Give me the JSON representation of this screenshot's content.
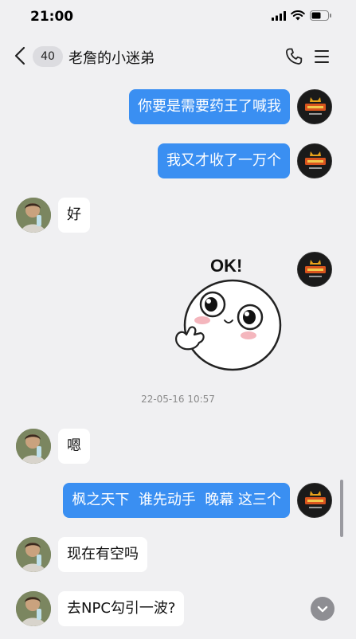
{
  "status_bar": {
    "time": "21:00"
  },
  "nav": {
    "unread_count": "40",
    "title": "老詹的小迷弟"
  },
  "messages": [
    {
      "side": "out",
      "text": "你要是需要药王了喊我"
    },
    {
      "side": "out",
      "text": "我又才收了一万个"
    },
    {
      "side": "in",
      "text": "好"
    },
    {
      "side": "out",
      "sticker": "ok-sticker",
      "sticker_text": "OK!"
    },
    {
      "side": "in",
      "text": "嗯"
    },
    {
      "side": "out",
      "text": "枫之天下  谁先动手  晚幕 这三个"
    },
    {
      "side": "in",
      "text": "现在有空吗"
    },
    {
      "side": "in",
      "text": "去NPC勾引一波?"
    }
  ],
  "timestamp_separator": "22-05-16 10:57",
  "self_avatar_logo": "易游网络",
  "colors": {
    "out_bubble": "#3a8ff2",
    "in_bubble": "#ffffff",
    "background": "#f0f0f2"
  }
}
